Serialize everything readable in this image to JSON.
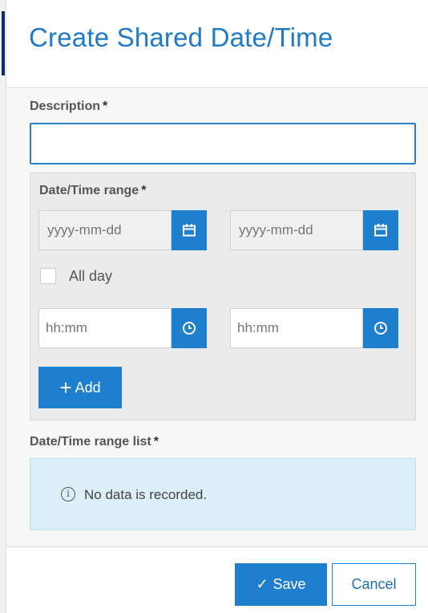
{
  "dialog": {
    "title": "Create Shared Date/Time"
  },
  "description": {
    "label": "Description",
    "required_mark": "*",
    "value": ""
  },
  "range": {
    "label": "Date/Time range",
    "required_mark": "*",
    "start_date_placeholder": "yyyy-mm-dd",
    "end_date_placeholder": "yyyy-mm-dd",
    "start_time_placeholder": "hh:mm",
    "end_time_placeholder": "hh:mm",
    "all_day_label": "All day",
    "all_day_checked": false,
    "add_label": "Add",
    "add_icon": "plus-icon",
    "date_icon": "calendar-icon",
    "time_icon": "clock-icon"
  },
  "range_list": {
    "label": "Date/Time range list",
    "required_mark": "*",
    "empty_message": "No data is recorded.",
    "info_icon": "info-icon"
  },
  "footer": {
    "save_label": "Save",
    "save_icon": "checkmark-icon",
    "cancel_label": "Cancel"
  },
  "colors": {
    "accent": "#1e7fcf",
    "title": "#1f7ac7",
    "info_background": "#dceef7"
  }
}
